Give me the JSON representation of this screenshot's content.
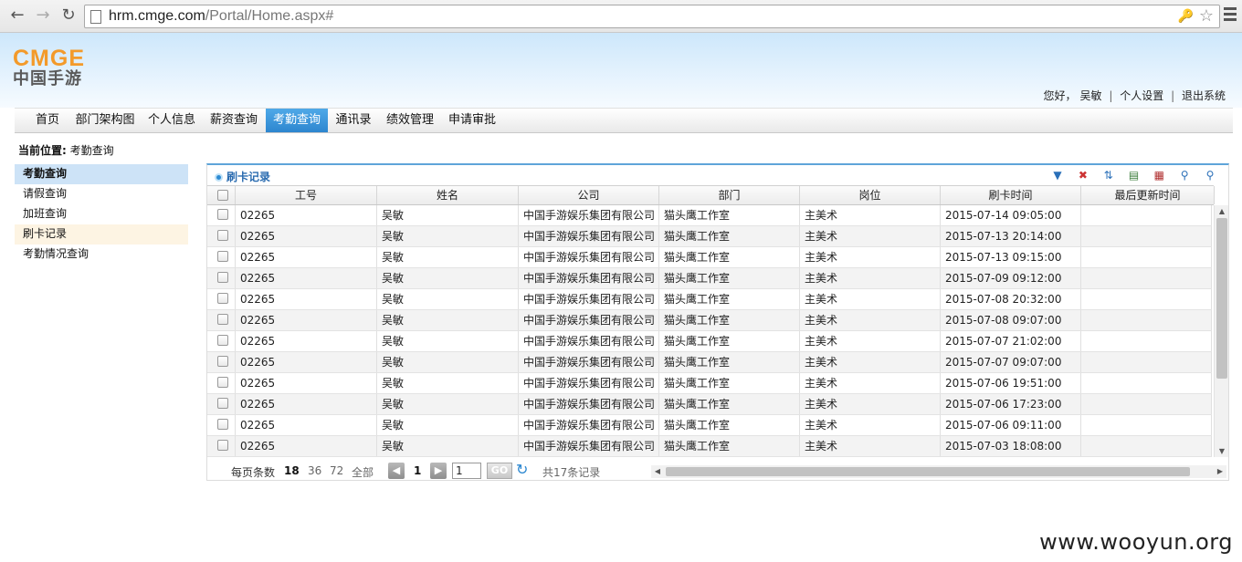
{
  "browser": {
    "url_host": "hrm.cmge.com",
    "url_path": "/Portal/Home.aspx#"
  },
  "header": {
    "logo_en": "CMGE",
    "logo_cn": "中国手游",
    "greeting": "您好，",
    "user_name": "吴敏",
    "settings_link": "个人设置",
    "logout_link": "退出系统"
  },
  "nav": {
    "items": [
      "首页",
      "部门架构图",
      "个人信息",
      "薪资查询",
      "考勤查询",
      "通讯录",
      "绩效管理",
      "申请审批"
    ],
    "active": "考勤查询"
  },
  "location": {
    "label": "当前位置:",
    "value": "考勤查询"
  },
  "sidebar": {
    "items": [
      "考勤查询",
      "请假查询",
      "加班查询",
      "刷卡记录",
      "考勤情况查询"
    ]
  },
  "panel": {
    "title": "刷卡记录"
  },
  "table": {
    "columns": [
      "工号",
      "姓名",
      "公司",
      "部门",
      "岗位",
      "刷卡时间",
      "最后更新时间"
    ],
    "rows": [
      [
        "02265",
        "吴敏",
        "中国手游娱乐集团有限公司",
        "猫头鹰工作室",
        "主美术",
        "2015-07-14 09:05:00",
        ""
      ],
      [
        "02265",
        "吴敏",
        "中国手游娱乐集团有限公司",
        "猫头鹰工作室",
        "主美术",
        "2015-07-13 20:14:00",
        ""
      ],
      [
        "02265",
        "吴敏",
        "中国手游娱乐集团有限公司",
        "猫头鹰工作室",
        "主美术",
        "2015-07-13 09:15:00",
        ""
      ],
      [
        "02265",
        "吴敏",
        "中国手游娱乐集团有限公司",
        "猫头鹰工作室",
        "主美术",
        "2015-07-09 09:12:00",
        ""
      ],
      [
        "02265",
        "吴敏",
        "中国手游娱乐集团有限公司",
        "猫头鹰工作室",
        "主美术",
        "2015-07-08 20:32:00",
        ""
      ],
      [
        "02265",
        "吴敏",
        "中国手游娱乐集团有限公司",
        "猫头鹰工作室",
        "主美术",
        "2015-07-08 09:07:00",
        ""
      ],
      [
        "02265",
        "吴敏",
        "中国手游娱乐集团有限公司",
        "猫头鹰工作室",
        "主美术",
        "2015-07-07 21:02:00",
        ""
      ],
      [
        "02265",
        "吴敏",
        "中国手游娱乐集团有限公司",
        "猫头鹰工作室",
        "主美术",
        "2015-07-07 09:07:00",
        ""
      ],
      [
        "02265",
        "吴敏",
        "中国手游娱乐集团有限公司",
        "猫头鹰工作室",
        "主美术",
        "2015-07-06 19:51:00",
        ""
      ],
      [
        "02265",
        "吴敏",
        "中国手游娱乐集团有限公司",
        "猫头鹰工作室",
        "主美术",
        "2015-07-06 17:23:00",
        ""
      ],
      [
        "02265",
        "吴敏",
        "中国手游娱乐集团有限公司",
        "猫头鹰工作室",
        "主美术",
        "2015-07-06 09:11:00",
        ""
      ],
      [
        "02265",
        "吴敏",
        "中国手游娱乐集团有限公司",
        "猫头鹰工作室",
        "主美术",
        "2015-07-03 18:08:00",
        ""
      ]
    ]
  },
  "pager": {
    "per_page_label": "每页条数",
    "size_18": "18",
    "size_36": "36",
    "size_72": "72",
    "size_all": "全部",
    "current_page": "1",
    "page_input": "1",
    "go_label": "GO",
    "total": "共17条记录"
  },
  "watermark": "www.wooyun.org",
  "colors": {
    "accent": "#2d86cf",
    "logo_orange": "#f39a2a"
  }
}
